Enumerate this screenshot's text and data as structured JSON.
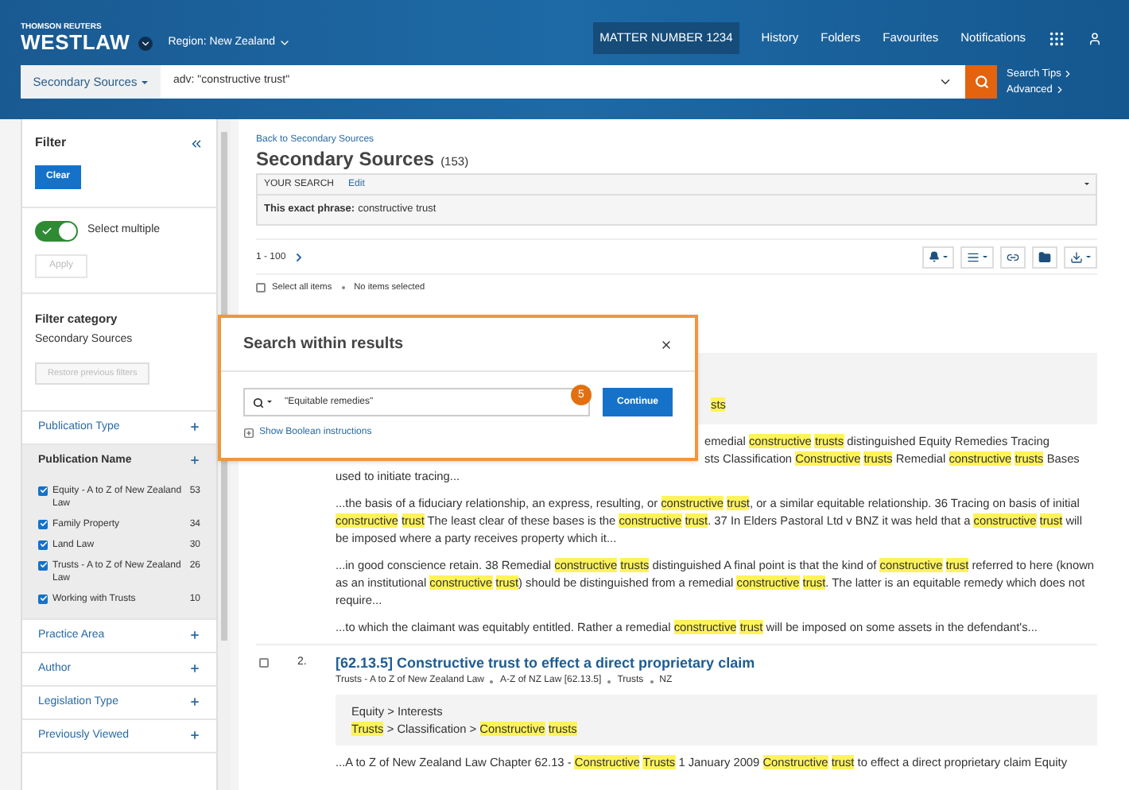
{
  "header": {
    "brand_top": "THOMSON REUTERS",
    "brand": "WESTLAW",
    "region": "Region: New Zealand",
    "matter": "MATTER NUMBER 1234",
    "nav": [
      "History",
      "Folders",
      "Favourites",
      "Notifications"
    ]
  },
  "search": {
    "scope": "Secondary Sources",
    "value": "adv: \"constructive trust\"",
    "links": [
      "Search Tips",
      "Advanced"
    ]
  },
  "sidebar": {
    "title": "Filter",
    "clear": "Clear",
    "toggle": {
      "label": "Select multiple",
      "on": true
    },
    "apply": {
      "label": "Apply",
      "disabled": true
    },
    "category_title": "Filter category",
    "category": "Secondary Sources",
    "restore": {
      "label": "Restore previous filters",
      "disabled": true
    },
    "facets": [
      {
        "label": "Publication Type",
        "expanded": false
      },
      {
        "label": "Publication Name",
        "expanded": true,
        "options": [
          {
            "label": "Equity - A to Z of New Zealand Law",
            "count": "53",
            "checked": true
          },
          {
            "label": "Family Property",
            "count": "34",
            "checked": true
          },
          {
            "label": "Land Law",
            "count": "30",
            "checked": true
          },
          {
            "label": "Trusts - A to Z of New Zealand Law",
            "count": "26",
            "checked": true
          },
          {
            "label": "Working with Trusts",
            "count": "10",
            "checked": true
          }
        ]
      },
      {
        "label": "Practice Area",
        "expanded": false
      },
      {
        "label": "Author",
        "expanded": false
      },
      {
        "label": "Legislation Type",
        "expanded": false
      },
      {
        "label": "Previously Viewed",
        "expanded": false
      }
    ]
  },
  "main": {
    "back": "Back to Secondary Sources",
    "title": "Secondary Sources",
    "count": "(153)",
    "your_search": {
      "label": "YOUR SEARCH",
      "edit": "Edit",
      "phrase_label": "This exact phrase:",
      "phrase": "constructive trust"
    },
    "pagination": "1 - 100",
    "select_all": "Select all items",
    "select_all_checked": false,
    "selected_info": "No items selected",
    "results": [
      {
        "breadcrumbs": [
          [
            {
              "text": "sts",
              "highlighted": true
            }
          ]
        ],
        "fragments": [
          {
            "covered_left": true,
            "segments": [
              {
                "text": "emedial",
                "highlighted": false
              },
              {
                "text": "constructive trusts",
                "highlighted": true
              },
              {
                "text": "distinguished Equity Remedies Tracing",
                "highlighted": false
              }
            ]
          },
          {
            "covered_left": true,
            "segments": [
              {
                "text": "sts Classification",
                "highlighted": false
              },
              {
                "text": "Constructive trusts",
                "highlighted": true
              },
              {
                "text": "Remedial",
                "highlighted": false
              },
              {
                "text": "constructive trusts",
                "highlighted": true
              },
              {
                "text": "Bases",
                "highlighted": false
              }
            ]
          },
          {
            "covered_left": false,
            "segments": [
              {
                "text": "used to initiate tracing...",
                "highlighted": false
              }
            ]
          }
        ],
        "snippets": [
          [
            {
              "text": "...the basis of a fiduciary relationship, an express, resulting, or",
              "highlighted": false
            },
            {
              "text": "constructive trust",
              "highlighted": true
            },
            {
              "text": ", or a similar equitable relationship. 36 Tracing on basis of initial",
              "highlighted": false
            },
            {
              "text": "constructive trust",
              "highlighted": true
            },
            {
              "text": "The least clear of these bases is the",
              "highlighted": false
            },
            {
              "text": "constructive trust",
              "highlighted": true
            },
            {
              "text": ". 37 In Elders Pastoral Ltd v BNZ it was held that a",
              "highlighted": false
            },
            {
              "text": "constructive trust",
              "highlighted": true
            },
            {
              "text": "will be imposed where a party receives property which it...",
              "highlighted": false
            }
          ],
          [
            {
              "text": "...in good conscience retain. 38 Remedial",
              "highlighted": false
            },
            {
              "text": "constructive trusts",
              "highlighted": true
            },
            {
              "text": "distinguished A final point is that the kind of",
              "highlighted": false
            },
            {
              "text": "constructive trust",
              "highlighted": true
            },
            {
              "text": "referred to here (known as an institutional",
              "highlighted": false
            },
            {
              "text": "constructive trust",
              "highlighted": true
            },
            {
              "text": ") should be distinguished from a remedial",
              "highlighted": false
            },
            {
              "text": "constructive trust",
              "highlighted": true
            },
            {
              "text": ". The latter is an equitable remedy which does not require...",
              "highlighted": false
            }
          ],
          [
            {
              "text": "...to which the claimant was equitably entitled. Rather a remedial",
              "highlighted": false
            },
            {
              "text": "constructive trust",
              "highlighted": true
            },
            {
              "text": "will be imposed on some assets in the defendant's...",
              "highlighted": false
            }
          ]
        ]
      },
      {
        "number": "2.",
        "checked": false,
        "title": "[62.13.5] Constructive trust to effect a direct proprietary claim",
        "meta": [
          "Trusts - A to Z of New Zealand Law",
          "A-Z of NZ Law [62.13.5]",
          "Trusts",
          "NZ"
        ],
        "breadcrumbs": [
          [
            {
              "text": "Equity > Interests",
              "highlighted": false
            }
          ],
          [
            {
              "text": "Trusts",
              "highlighted": true
            },
            {
              "text": "> Classification >",
              "highlighted": false
            },
            {
              "text": "Constructive trusts",
              "highlighted": true
            }
          ]
        ],
        "snippets": [
          [
            {
              "text": "...A to Z of New Zealand Law Chapter 62.13 -",
              "highlighted": false
            },
            {
              "text": "Constructive Trusts",
              "highlighted": true
            },
            {
              "text": "1 January 2009",
              "highlighted": false
            },
            {
              "text": "Constructive trust",
              "highlighted": true
            },
            {
              "text": "to effect a direct proprietary claim Equity",
              "highlighted": false
            }
          ]
        ]
      }
    ]
  },
  "dialog": {
    "title": "Search within results",
    "value": "\"Equitable remedies\"",
    "badge": "5",
    "button": "Continue",
    "link": "Show Boolean instructions"
  }
}
